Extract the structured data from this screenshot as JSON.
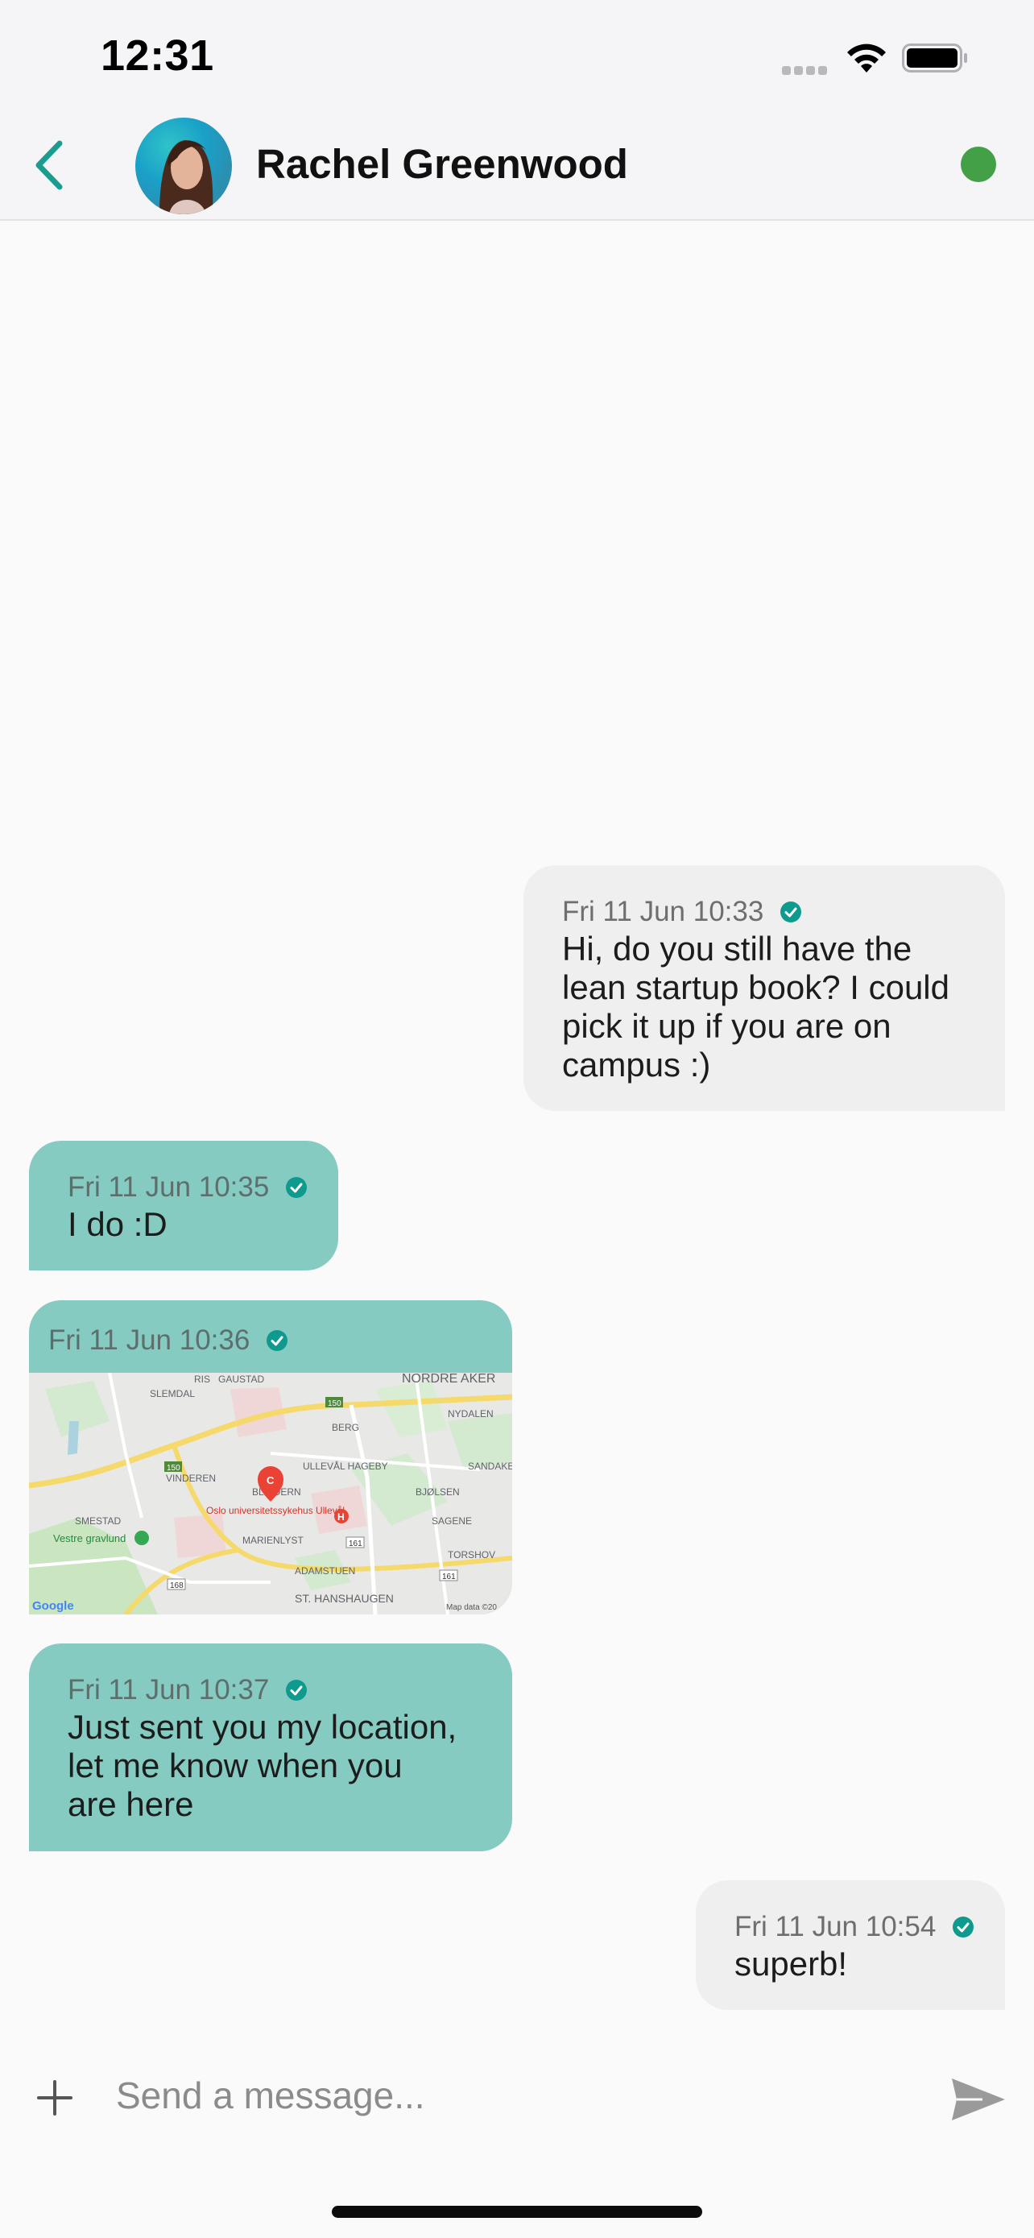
{
  "status_bar": {
    "time": "12:31",
    "icons": [
      "signal-icon",
      "wifi-icon",
      "battery-icon"
    ]
  },
  "header": {
    "contact_name": "Rachel Greenwood",
    "presence": "online",
    "icons": [
      "back-chevron-icon",
      "avatar",
      "online-status-dot"
    ],
    "colors": {
      "accent": "#1a9c8f",
      "online": "#43a047"
    }
  },
  "messages": [
    {
      "direction": "sent",
      "timestamp": "Fri 11 Jun 10:33",
      "text": "Hi, do you still have the\nlean startup book? I could\npick it up if you are on\ncampus :)"
    },
    {
      "direction": "received",
      "timestamp": "Fri 11 Jun 10:35",
      "text": "I do :D"
    },
    {
      "direction": "received",
      "timestamp": "Fri 11 Jun 10:36",
      "type": "location",
      "map": {
        "labels": [
          "RIS",
          "GAUSTAD",
          "NORDRE AKER",
          "SLEMDAL",
          "BERG",
          "NYDALEN",
          "VINDEREN",
          "ULLEVÅL HAGEBY",
          "SANDAKER",
          "BLINDERN",
          "Oslo universitetssykehus Ullevål",
          "BJØLSEN",
          "SMESTAD",
          "SAGENE",
          "Vestre gravlund",
          "MARIENLYST",
          "TORSHOV",
          "ADAMSTUEN",
          "ST. HANSHAUGEN"
        ],
        "road_shields": [
          "150",
          "150",
          "161",
          "168",
          "161"
        ],
        "marker": "C",
        "attribution": "Map data ©20",
        "logo": "Google"
      }
    },
    {
      "direction": "received",
      "timestamp": "Fri 11 Jun 10:37",
      "text": "Just sent you my location,\nlet me know when you\nare here"
    },
    {
      "direction": "sent",
      "timestamp": "Fri 11 Jun 10:54",
      "text": "superb!"
    }
  ],
  "message_status_icon": "check-circle-icon",
  "composer": {
    "placeholder": "Send a message...",
    "icons": [
      "plus-icon",
      "send-icon"
    ]
  },
  "colors": {
    "sent_bubble": "#efefef",
    "received_bubble": "#85cbc1",
    "check": "#0f9a8e",
    "background": "#fafafa"
  }
}
